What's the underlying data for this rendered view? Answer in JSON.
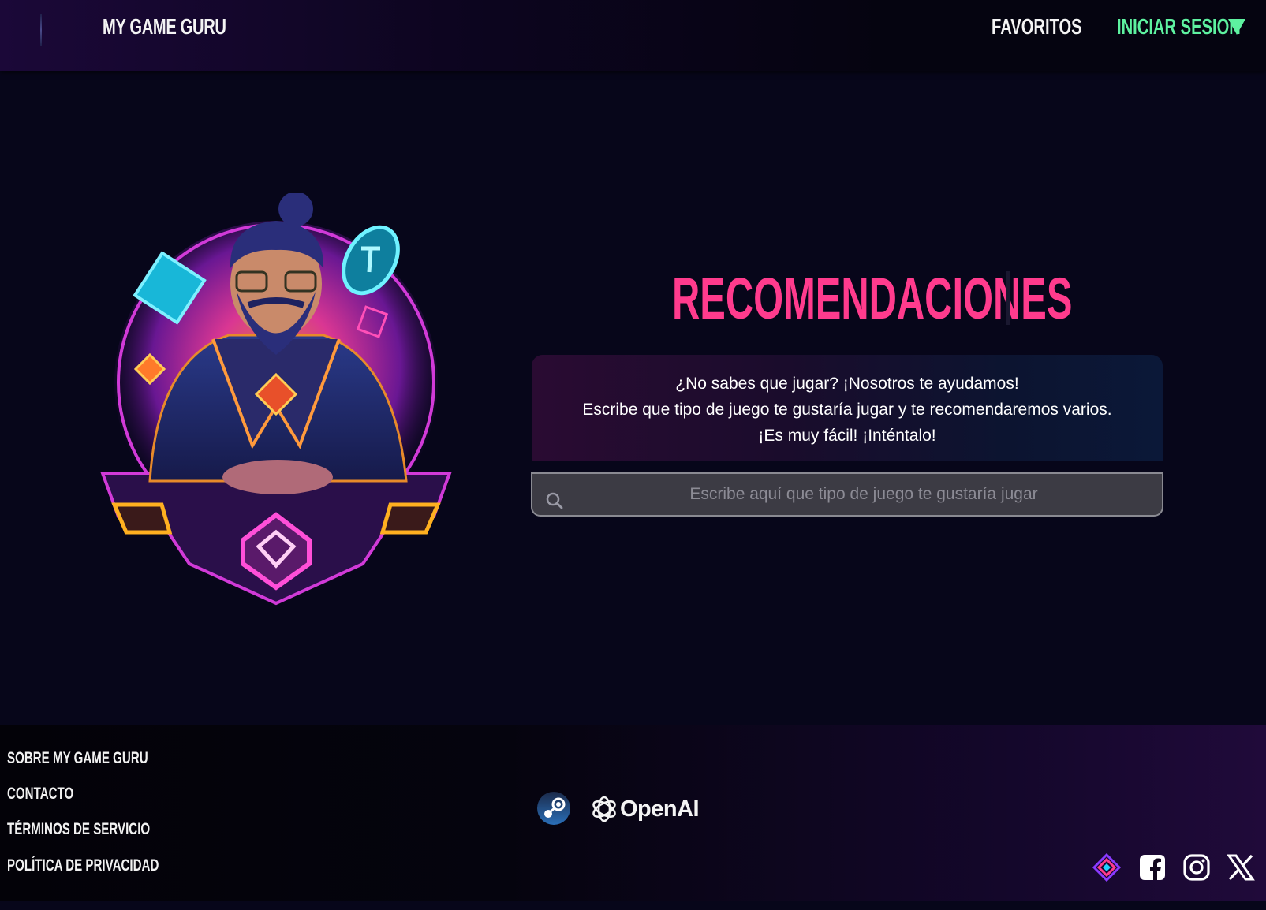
{
  "header": {
    "brand": "MY GAME GURU",
    "nav": {
      "favorites": "FAVORITOS",
      "login": "INICIAR SESION"
    }
  },
  "main": {
    "title": "RECOMENDACIONES",
    "intro": [
      "¿No sabes que jugar? ¡Nosotros te ayudamos!",
      "Escribe que tipo de juego te gustaría jugar y te recomendaremos varios.",
      "¡Es muy fácil! ¡Inténtalo!"
    ],
    "search": {
      "placeholder": "Escribe aquí que tipo de juego te gustaría jugar",
      "value": ""
    }
  },
  "footer": {
    "links": [
      "SOBRE MY GAME GURU",
      "CONTACTO",
      "TÉRMINOS DE SERVICIO",
      "POLÍTICA DE PRIVACIDAD"
    ],
    "partners": {
      "openai": "OpenAI"
    },
    "social_icons": [
      "app-logo-icon",
      "facebook-icon",
      "instagram-icon",
      "x-icon"
    ]
  },
  "colors": {
    "accent_pink": "#ff3b8d",
    "accent_green": "#5ef2a0",
    "background": "#07061a"
  }
}
